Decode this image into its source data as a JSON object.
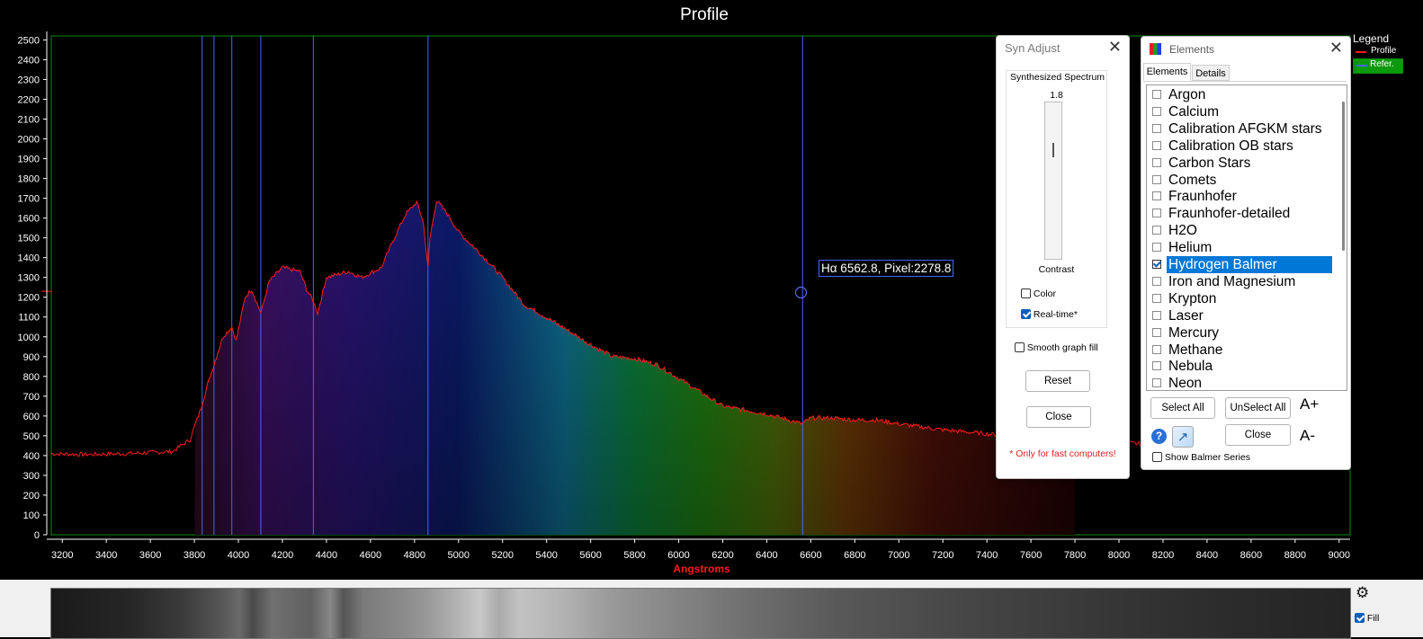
{
  "chart_data": {
    "type": "area",
    "title": "Profile",
    "xlabel": "Angstroms",
    "ylabel": "",
    "xlim": [
      3150,
      9050
    ],
    "ylim": [
      0,
      2520
    ],
    "x_ticks": [
      3200,
      3400,
      3600,
      3800,
      4000,
      4200,
      4400,
      4600,
      4800,
      5000,
      5200,
      5400,
      5600,
      5800,
      6000,
      6200,
      6400,
      6600,
      6800,
      7000,
      7200,
      7400,
      7600,
      7800,
      8000,
      8200,
      8400,
      8600,
      8800,
      9000
    ],
    "y_ticks": [
      0,
      100,
      200,
      300,
      400,
      500,
      600,
      700,
      800,
      900,
      1000,
      1100,
      1200,
      1300,
      1400,
      1500,
      1600,
      1700,
      1800,
      1900,
      2000,
      2100,
      2200,
      2300,
      2400,
      2500
    ],
    "series": [
      {
        "name": "Profile",
        "color": "#ff1a1a",
        "x": [
          3150,
          3300,
          3500,
          3700,
          3780,
          3830,
          3860,
          3900,
          3930,
          3970,
          3990,
          4030,
          4060,
          4102,
          4140,
          4200,
          4280,
          4310,
          4340,
          4360,
          4400,
          4500,
          4560,
          4650,
          4700,
          4760,
          4810,
          4840,
          4861,
          4870,
          4900,
          4950,
          5000,
          5100,
          5200,
          5300,
          5350,
          5500,
          5600,
          5700,
          5800,
          5900,
          6000,
          6100,
          6200,
          6300,
          6400,
          6500,
          6560,
          6600,
          6700,
          6800,
          6900,
          7000,
          7200,
          7400,
          7600,
          7800,
          8000,
          8200,
          8400,
          8600,
          8800,
          9000,
          9050
        ],
        "y": [
          410,
          405,
          410,
          420,
          480,
          640,
          760,
          900,
          1000,
          1050,
          980,
          1200,
          1240,
          1120,
          1280,
          1350,
          1330,
          1240,
          1180,
          1120,
          1300,
          1330,
          1300,
          1350,
          1480,
          1620,
          1680,
          1580,
          1350,
          1500,
          1690,
          1620,
          1530,
          1420,
          1300,
          1160,
          1130,
          1030,
          960,
          900,
          890,
          860,
          790,
          720,
          650,
          630,
          610,
          580,
          560,
          590,
          590,
          580,
          580,
          560,
          530,
          510,
          490,
          475,
          465,
          455,
          450,
          445,
          440,
          435,
          435
        ]
      },
      {
        "name": "Refer.",
        "color": "#4466ff"
      }
    ],
    "reference_lines_angstrom": [
      3835.4,
      3889.1,
      3970.1,
      4101.7,
      4340.5,
      4861.3,
      6562.8
    ],
    "marker_label": "Hα  6562.8, Pixel:2278.8",
    "fill_range": [
      3800,
      7800
    ],
    "grid": false,
    "legend_position": "top-right"
  },
  "legend": {
    "title": "Legend",
    "items": [
      "Profile",
      "Refer."
    ]
  },
  "syn_adjust": {
    "title": "Syn Adjust",
    "group_label": "Synthesized Spectrum",
    "slider_value": "1.8",
    "slider_caption": "Contrast",
    "color_label": "Color",
    "color_checked": false,
    "realtime_label": "Real-time*",
    "realtime_checked": true,
    "smooth_label": "Smooth graph fill",
    "smooth_checked": false,
    "reset_label": "Reset",
    "close_label": "Close",
    "note": "* Only for fast computers!"
  },
  "elements": {
    "title": "Elements",
    "tabs": [
      "Elements",
      "Details"
    ],
    "items": [
      {
        "label": "Argon",
        "checked": false
      },
      {
        "label": "Calcium",
        "checked": false
      },
      {
        "label": "Calibration AFGKM stars",
        "checked": false
      },
      {
        "label": "Calibration OB stars",
        "checked": false
      },
      {
        "label": "Carbon Stars",
        "checked": false
      },
      {
        "label": "Comets",
        "checked": false
      },
      {
        "label": "Fraunhofer",
        "checked": false
      },
      {
        "label": "Fraunhofer-detailed",
        "checked": false
      },
      {
        "label": "H2O",
        "checked": false
      },
      {
        "label": "Helium",
        "checked": false
      },
      {
        "label": "Hydrogen Balmer",
        "checked": true
      },
      {
        "label": "Iron and Magnesium",
        "checked": false
      },
      {
        "label": "Krypton",
        "checked": false
      },
      {
        "label": "Laser",
        "checked": false
      },
      {
        "label": "Mercury",
        "checked": false
      },
      {
        "label": "Methane",
        "checked": false
      },
      {
        "label": "Nebula",
        "checked": false
      },
      {
        "label": "Neon",
        "checked": false
      }
    ],
    "select_all_label": "Select All",
    "unselect_all_label": "UnSelect All",
    "font_up_label": "A+",
    "font_down_label": "A-",
    "close_label": "Close",
    "show_balmer_label": "Show Balmer Series",
    "show_balmer_checked": false,
    "help_icon": "?"
  },
  "strip": {
    "fill_label": "Fill",
    "fill_checked": true
  },
  "colors": {
    "profile": "#ff1a1a",
    "reference": "#4466ff",
    "axis_label": "#ff1a1a",
    "selection": "#0078d7"
  }
}
